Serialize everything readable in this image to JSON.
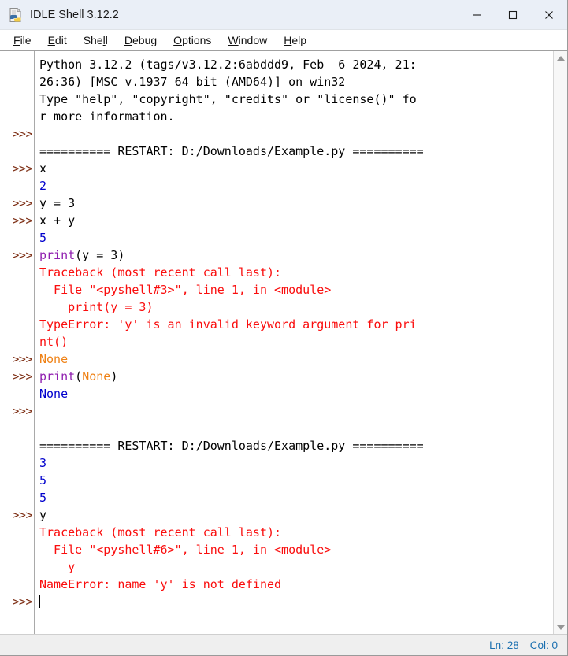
{
  "window": {
    "title": "IDLE Shell 3.12.2",
    "icon": "python-file-icon",
    "controls": {
      "minimize": "minimize-icon",
      "maximize": "maximize-icon",
      "close": "close-icon"
    }
  },
  "menubar": {
    "items": [
      {
        "label": "File",
        "mnemonic": "F",
        "pre": "",
        "post": "ile"
      },
      {
        "label": "Edit",
        "mnemonic": "E",
        "pre": "",
        "post": "dit"
      },
      {
        "label": "Shell",
        "mnemonic": "l",
        "pre": "She",
        "post": "l"
      },
      {
        "label": "Debug",
        "mnemonic": "D",
        "pre": "",
        "post": "ebug"
      },
      {
        "label": "Options",
        "mnemonic": "O",
        "pre": "",
        "post": "ptions"
      },
      {
        "label": "Window",
        "mnemonic": "W",
        "pre": "",
        "post": "indow"
      },
      {
        "label": "Help",
        "mnemonic": "H",
        "pre": "",
        "post": "elp"
      }
    ]
  },
  "colors": {
    "prompt": "#7d2e14",
    "code": "#000000",
    "output": "#0000cd",
    "error": "#fa0d0d",
    "builtin": "#9020b0",
    "keyword": "#ef8114",
    "titlebar": "#eaeff7",
    "status_text": "#1a6fb0"
  },
  "shell": {
    "prompt": ">>>",
    "lines": [
      {
        "prompt": "",
        "segments": [
          {
            "text": "Python 3.12.2 (tags/v3.12.2:6abddd9, Feb  6 2024, 21:",
            "style": "normal"
          }
        ]
      },
      {
        "prompt": "",
        "segments": [
          {
            "text": "26:36) [MSC v.1937 64 bit (AMD64)] on win32",
            "style": "normal"
          }
        ]
      },
      {
        "prompt": "",
        "segments": [
          {
            "text": "Type \"help\", \"copyright\", \"credits\" or \"license()\" fo",
            "style": "normal"
          }
        ]
      },
      {
        "prompt": "",
        "segments": [
          {
            "text": "r more information.",
            "style": "normal"
          }
        ]
      },
      {
        "prompt": ">>>",
        "segments": [
          {
            "text": "",
            "style": "normal"
          }
        ]
      },
      {
        "prompt": "",
        "segments": [
          {
            "text": "========== RESTART: D:/Downloads/Example.py ==========",
            "style": "restart"
          }
        ]
      },
      {
        "prompt": ">>>",
        "segments": [
          {
            "text": "x",
            "style": "normal"
          }
        ]
      },
      {
        "prompt": "",
        "segments": [
          {
            "text": "2",
            "style": "output"
          }
        ]
      },
      {
        "prompt": ">>>",
        "segments": [
          {
            "text": "y = 3",
            "style": "normal"
          }
        ]
      },
      {
        "prompt": ">>>",
        "segments": [
          {
            "text": "x + y",
            "style": "normal"
          }
        ]
      },
      {
        "prompt": "",
        "segments": [
          {
            "text": "5",
            "style": "output"
          }
        ]
      },
      {
        "prompt": ">>>",
        "segments": [
          {
            "text": "print",
            "style": "builtin"
          },
          {
            "text": "(y = 3)",
            "style": "normal"
          }
        ]
      },
      {
        "prompt": "",
        "segments": [
          {
            "text": "Traceback (most recent call last):",
            "style": "error"
          }
        ]
      },
      {
        "prompt": "",
        "segments": [
          {
            "text": "  File \"<pyshell#3>\", line 1, in <module>",
            "style": "error"
          }
        ]
      },
      {
        "prompt": "",
        "segments": [
          {
            "text": "    print(y = 3)",
            "style": "error"
          }
        ]
      },
      {
        "prompt": "",
        "segments": [
          {
            "text": "TypeError: 'y' is an invalid keyword argument for pri",
            "style": "error"
          }
        ]
      },
      {
        "prompt": "",
        "segments": [
          {
            "text": "nt()",
            "style": "error"
          }
        ]
      },
      {
        "prompt": ">>>",
        "segments": [
          {
            "text": "None",
            "style": "keyword"
          }
        ]
      },
      {
        "prompt": ">>>",
        "segments": [
          {
            "text": "print",
            "style": "builtin"
          },
          {
            "text": "(",
            "style": "normal"
          },
          {
            "text": "None",
            "style": "keyword"
          },
          {
            "text": ")",
            "style": "normal"
          }
        ]
      },
      {
        "prompt": "",
        "segments": [
          {
            "text": "None",
            "style": "output"
          }
        ]
      },
      {
        "prompt": ">>>",
        "segments": [
          {
            "text": "",
            "style": "normal"
          }
        ]
      },
      {
        "prompt": "",
        "segments": [
          {
            "text": "",
            "style": "normal"
          }
        ]
      },
      {
        "prompt": "",
        "segments": [
          {
            "text": "========== RESTART: D:/Downloads/Example.py ==========",
            "style": "restart"
          }
        ]
      },
      {
        "prompt": "",
        "segments": [
          {
            "text": "3",
            "style": "output"
          }
        ]
      },
      {
        "prompt": "",
        "segments": [
          {
            "text": "5",
            "style": "output"
          }
        ]
      },
      {
        "prompt": "",
        "segments": [
          {
            "text": "5",
            "style": "output"
          }
        ]
      },
      {
        "prompt": ">>>",
        "segments": [
          {
            "text": "y",
            "style": "normal"
          }
        ]
      },
      {
        "prompt": "",
        "segments": [
          {
            "text": "Traceback (most recent call last):",
            "style": "error"
          }
        ]
      },
      {
        "prompt": "",
        "segments": [
          {
            "text": "  File \"<pyshell#6>\", line 1, in <module>",
            "style": "error"
          }
        ]
      },
      {
        "prompt": "",
        "segments": [
          {
            "text": "    y",
            "style": "error"
          }
        ]
      },
      {
        "prompt": "",
        "segments": [
          {
            "text": "NameError: name 'y' is not defined",
            "style": "error"
          }
        ]
      },
      {
        "prompt": ">>>",
        "segments": [
          {
            "text": "",
            "style": "normal",
            "caret": true
          }
        ]
      }
    ]
  },
  "scrollbar": {
    "up_arrow": "scroll-up-arrow-icon",
    "down_arrow": "scroll-down-arrow-icon"
  },
  "statusbar": {
    "line_label": "Ln: 28",
    "col_label": "Col: 0"
  }
}
